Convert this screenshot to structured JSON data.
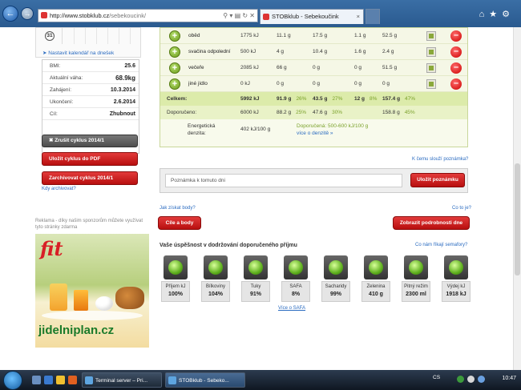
{
  "browser": {
    "url_host": "http://www.stobklub.cz",
    "url_path": "/sebekoucink/",
    "tab_title": "STOBklub - Sebekoučink"
  },
  "calendar": {
    "day": "31",
    "set_link": "Nastavit kalendář na dnešek"
  },
  "stats": [
    {
      "key": "BMI:",
      "value": "25.6"
    },
    {
      "key": "Aktuální váha:",
      "value": "68.9kg"
    },
    {
      "key": "Zahájení:",
      "value": "10.3.2014"
    },
    {
      "key": "Ukončení:",
      "value": "2.6.2014"
    },
    {
      "key": "Cíl:",
      "value": "Zhubnout"
    }
  ],
  "buttons": {
    "cancel_cycle": "Zrušit cyklus 2014/1",
    "save_pdf": "Uložit cyklus do PDF",
    "archive_cycle": "Zarchivovat cyklus 2014/1",
    "when_archive": "Kdy archivovat?",
    "save_note": "Uložit poznámku",
    "goals": "Cíle a body",
    "details": "Zobrazit podrobnosti dne"
  },
  "ad": {
    "text": "Reklama - díky našim sponzorům můžete využívat tyto stránky zdarma",
    "logo": "fit",
    "site": "jidelniplan.cz"
  },
  "meals": [
    {
      "name": "oběd",
      "energy": "1775 kJ",
      "protein": "11.1 g",
      "carbs": "17.5 g",
      "fat": "1.1 g",
      "fiber": "52.5 g"
    },
    {
      "name": "svačina odpolední",
      "energy": "500 kJ",
      "protein": "4 g",
      "carbs": "10.4 g",
      "fat": "1.6 g",
      "fiber": "2.4 g"
    },
    {
      "name": "večeře",
      "energy": "2085 kJ",
      "protein": "66 g",
      "carbs": "0 g",
      "fat": "0 g",
      "fiber": "51.5 g"
    },
    {
      "name": "jiné jídlo",
      "energy": "0 kJ",
      "protein": "0 g",
      "carbs": "0 g",
      "fat": "0 g",
      "fiber": "0 g"
    }
  ],
  "totals": {
    "label": "Celkem:",
    "energy": "5992 kJ",
    "protein": "91.9 g",
    "protein_pct": "26%",
    "carbs": "43.5 g",
    "carbs_pct": "27%",
    "fat": "12 g",
    "fat_pct": "8%",
    "fiber": "157.4 g",
    "fiber_pct": "47%"
  },
  "recommended": {
    "label": "Doporučeno:",
    "energy": "6000 kJ",
    "protein": "88.2 g",
    "protein_pct": "25%",
    "carbs": "47.6 g",
    "carbs_pct": "30%",
    "fiber": "158.8 g",
    "fiber_pct": "45%"
  },
  "energy_density": {
    "label": "Energetická denzita:",
    "value": "402 kJ/100 g",
    "recommended": "Doporučená: 500-600 kJ/100 g",
    "more_link": "více o denzitě »"
  },
  "note": {
    "purpose_link": "K čemu slouží poznámka?",
    "placeholder": "Poznámka k tomuto dni"
  },
  "links": {
    "how_points": "Jak získat body?",
    "what_is": "Co to je?",
    "lights_link": "Co nám říkají semafory?",
    "safa_link": "Více o SAFA"
  },
  "success": {
    "title": "Vaše úspěšnost v dodržování doporučeného příjmu",
    "items": [
      {
        "label": "Příjem kJ",
        "value": "100%"
      },
      {
        "label": "Bílkoviny",
        "value": "104%"
      },
      {
        "label": "Tuky",
        "value": "91%"
      },
      {
        "label": "SAFA",
        "value": "8%"
      },
      {
        "label": "Sacharidy",
        "value": "99%"
      },
      {
        "label": "Zelenina",
        "value": "410 g"
      },
      {
        "label": "Pitný režim",
        "value": "2300 ml"
      },
      {
        "label": "Výdej kJ",
        "value": "1918 kJ"
      }
    ]
  },
  "taskbar": {
    "task1": "Terminal server – Pri...",
    "task2": "STOBklub - Sebeko...",
    "lang": "CS",
    "clock": "10:47"
  }
}
